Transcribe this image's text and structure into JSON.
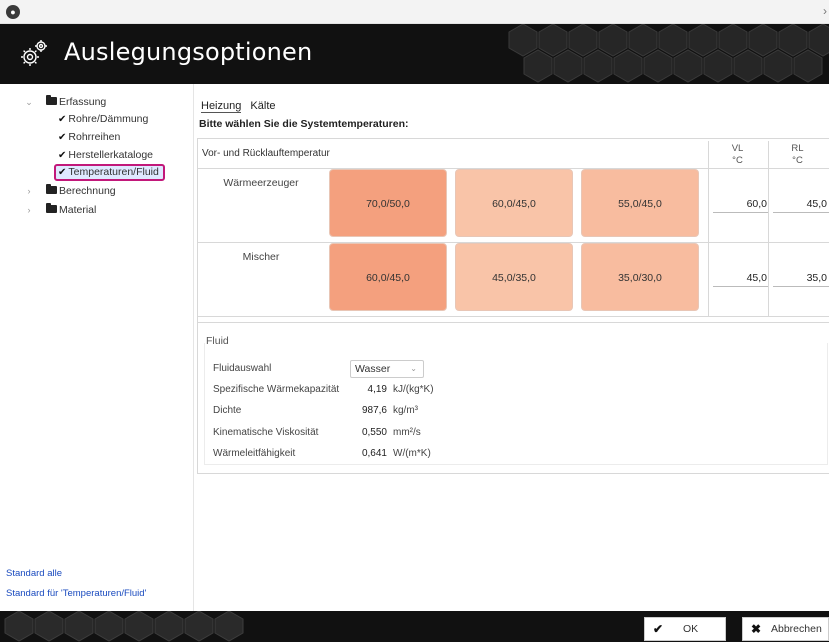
{
  "app": {
    "icon_text": "●"
  },
  "header": {
    "title": "Auslegungsoptionen"
  },
  "sidebar": {
    "tree": {
      "root_label": "Erfassung",
      "children": [
        "Rohre/Dämmung",
        "Rohrreihen",
        "Herstellerkataloge",
        "Temperaturen/Fluid"
      ],
      "selected": "Temperaturen/Fluid",
      "siblings": [
        "Berechnung",
        "Material"
      ]
    },
    "link_default_all": "Standard alle",
    "link_default_section": "Standard für 'Temperaturen/Fluid'"
  },
  "tabs": [
    {
      "label": "Heizung",
      "active": true
    },
    {
      "label": "Kälte",
      "active": false
    }
  ],
  "section_title": "Bitte wählen Sie die Systemtemperaturen:",
  "temperatures": {
    "header_label": "Vor- und Rücklauftemperatur",
    "col_vl": "VL",
    "col_rl": "RL",
    "unit": "°C",
    "rows": [
      {
        "label": "Wärmeerzeuger",
        "options": [
          "70,0/50,0",
          "60,0/45,0",
          "55,0/45,0"
        ],
        "vl": "60,0",
        "rl": "45,0"
      },
      {
        "label": "Mischer",
        "options": [
          "60,0/45,0",
          "45,0/35,0",
          "35,0/30,0"
        ],
        "vl": "45,0",
        "rl": "35,0"
      }
    ],
    "colors": {
      "strong": "#f4a07e",
      "medium": "#f8bc9f",
      "light": "#f9c4a8"
    }
  },
  "fluid": {
    "legend": "Fluid",
    "selection_label": "Fluidauswahl",
    "selection_value": "Wasser",
    "properties": [
      {
        "label": "Spezifische Wärmekapazität",
        "value": "4,19",
        "unit": "kJ/(kg*K)"
      },
      {
        "label": "Dichte",
        "value": "987,6",
        "unit": "kg/m³"
      },
      {
        "label": "Kinematische Viskosität",
        "value": "0,550",
        "unit": "mm²/s"
      },
      {
        "label": "Wärmeleitfähigkeit",
        "value": "0,641",
        "unit": "W/(m*K)"
      }
    ]
  },
  "footer": {
    "ok_label": "OK",
    "cancel_label": "Abbrechen"
  },
  "accent": {
    "selection_border": "#c2187a",
    "link": "#1a4bbf"
  }
}
